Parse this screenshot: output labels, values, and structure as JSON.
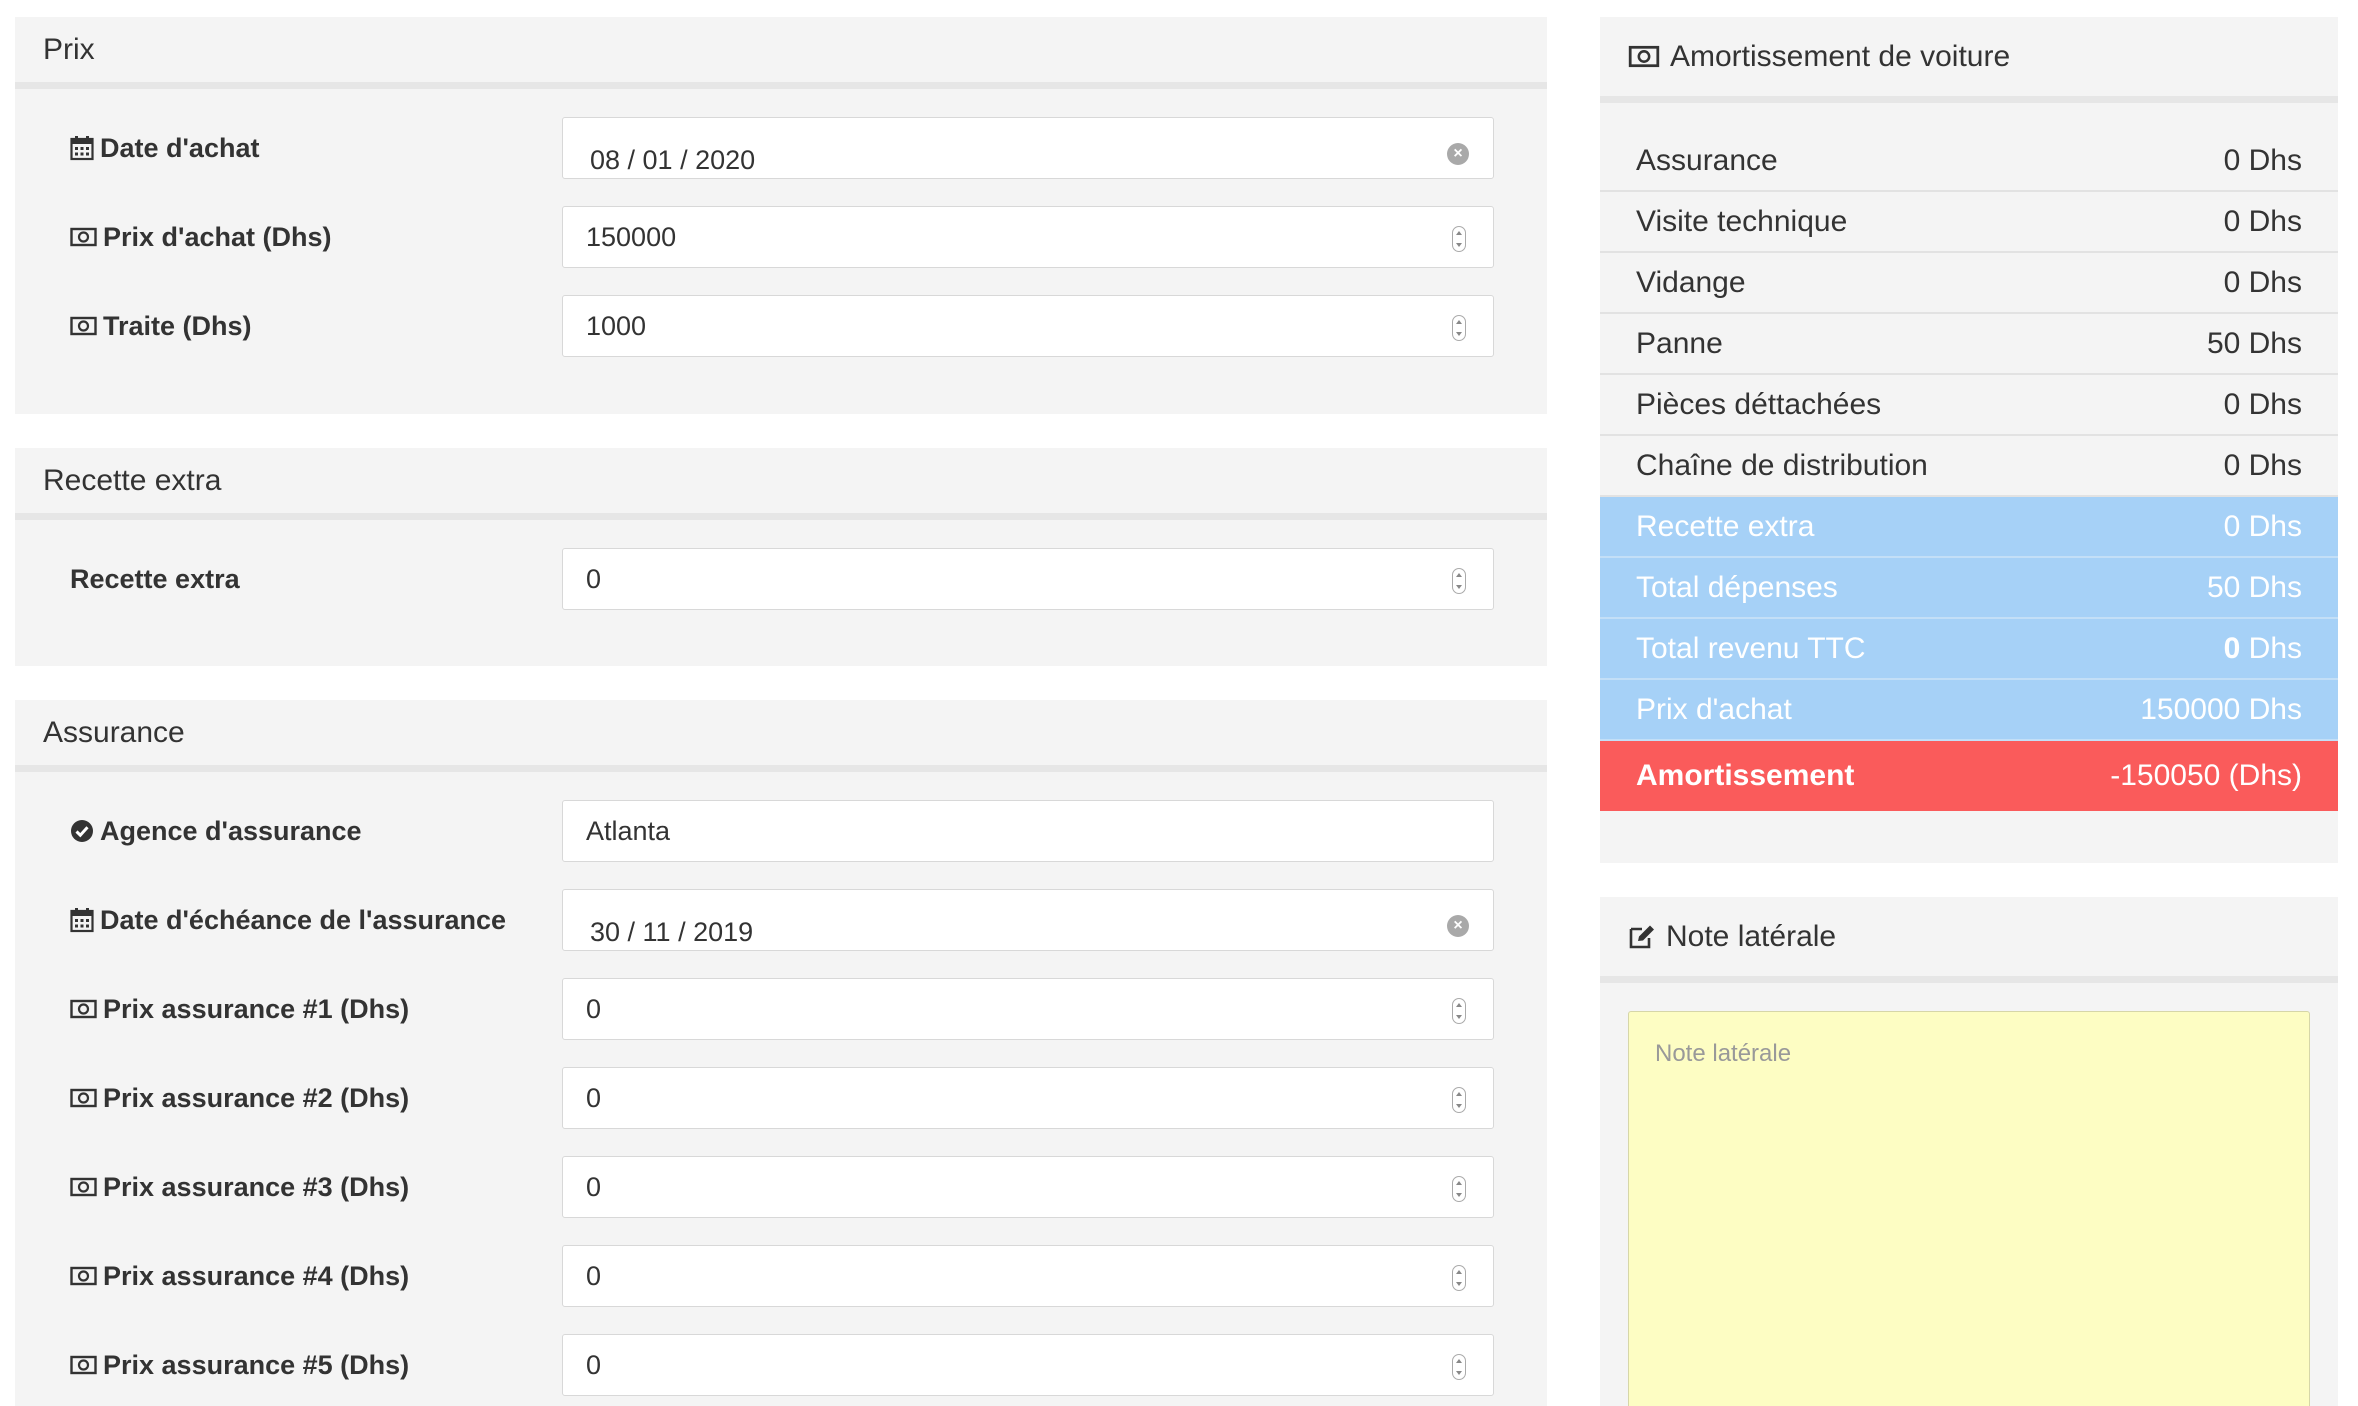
{
  "prix": {
    "title": "Prix",
    "date_achat_label": "Date d'achat",
    "date_achat_value": "08 / 01 / 2020",
    "prix_achat_label": "Prix d'achat (Dhs)",
    "prix_achat_value": "150000",
    "traite_label": "Traite (Dhs)",
    "traite_value": "1000"
  },
  "recette": {
    "title": "Recette extra",
    "label": "Recette extra",
    "value": "0"
  },
  "assurance": {
    "title": "Assurance",
    "agence_label": "Agence d'assurance",
    "agence_value": "Atlanta",
    "echeance_label": "Date d'échéance de l'assurance",
    "echeance_value": "30 / 11 / 2019",
    "prix_items": [
      {
        "label": "Prix assurance #1 (Dhs)",
        "value": "0"
      },
      {
        "label": "Prix assurance #2 (Dhs)",
        "value": "0"
      },
      {
        "label": "Prix assurance #3 (Dhs)",
        "value": "0"
      },
      {
        "label": "Prix assurance #4 (Dhs)",
        "value": "0"
      },
      {
        "label": "Prix assurance #5 (Dhs)",
        "value": "0"
      }
    ]
  },
  "summary": {
    "title": "Amortissement de voiture",
    "rows": [
      {
        "label": "Assurance",
        "value": "0 Dhs"
      },
      {
        "label": "Visite technique",
        "value": "0 Dhs"
      },
      {
        "label": "Vidange",
        "value": "0 Dhs"
      },
      {
        "label": "Panne",
        "value": "50 Dhs"
      },
      {
        "label": "Pièces déttachées",
        "value": "0 Dhs"
      },
      {
        "label": "Chaîne de distribution",
        "value": "0 Dhs"
      }
    ],
    "highlight_rows": [
      {
        "label": "Recette extra",
        "value": "0 Dhs"
      },
      {
        "label": "Total dépenses",
        "value": "50 Dhs"
      },
      {
        "label": "Total revenu TTC",
        "value_bold": "0",
        "value_unit": " Dhs"
      },
      {
        "label": "Prix d'achat",
        "value": "150000 Dhs"
      }
    ],
    "result": {
      "label": "Amortissement",
      "value": "-150050 (Dhs)"
    }
  },
  "note": {
    "title": "Note latérale",
    "placeholder": "Note latérale"
  },
  "colors": {
    "highlight_blue": "#a6d1f7",
    "result_red": "#fa5b5b",
    "note_yellow": "#fdfdc3",
    "panel_gray": "#f4f4f4"
  }
}
